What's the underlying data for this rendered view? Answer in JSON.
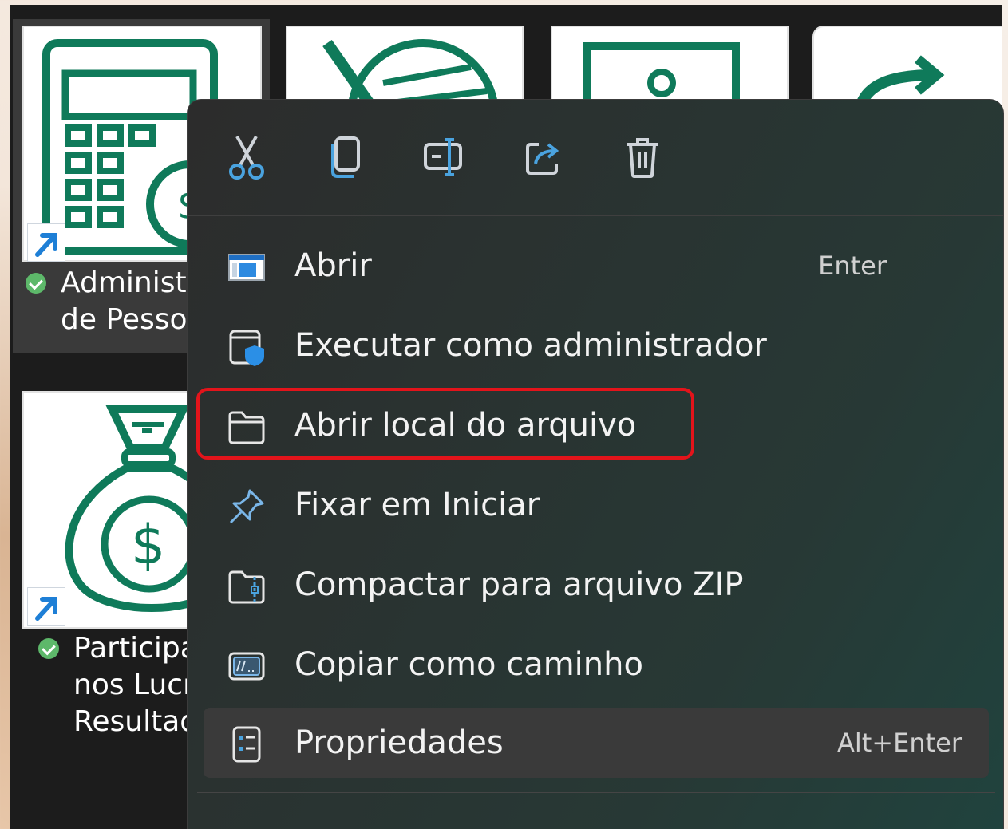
{
  "files": [
    {
      "id": "file-admin",
      "lines": [
        "Administr",
        "de Pessoa"
      ],
      "icon": "calculator-dollar-icon"
    },
    {
      "id": "file-participacao",
      "lines": [
        "Participa",
        "nos Lucr",
        "Resultad"
      ],
      "icon": "money-bag-icon"
    },
    {
      "id": "file-tile-3",
      "icon": "no-money-icon"
    },
    {
      "id": "file-tile-4",
      "icon": "id-card-icon"
    },
    {
      "id": "file-tile-5",
      "icon": "transfer-arrow-icon"
    }
  ],
  "toolbar": {
    "actions": [
      {
        "name": "cut",
        "icon": "scissors-icon"
      },
      {
        "name": "copy",
        "icon": "copy-icon"
      },
      {
        "name": "rename",
        "icon": "rename-icon"
      },
      {
        "name": "share",
        "icon": "share-icon"
      },
      {
        "name": "delete",
        "icon": "trash-icon"
      }
    ]
  },
  "menu": {
    "items": [
      {
        "label": "Abrir",
        "shortcut": "Enter",
        "icon": "open-window-icon"
      },
      {
        "label": "Executar como administrador",
        "shortcut": "",
        "icon": "shield-admin-icon"
      },
      {
        "label": "Abrir local do arquivo",
        "shortcut": "",
        "icon": "folder-icon",
        "highlighted": true
      },
      {
        "label": "Fixar em Iniciar",
        "shortcut": "",
        "icon": "pin-icon"
      },
      {
        "label": "Compactar para arquivo ZIP",
        "shortcut": "",
        "icon": "zip-folder-icon"
      },
      {
        "label": "Copiar como caminho",
        "shortcut": "",
        "icon": "path-icon"
      },
      {
        "label": "Propriedades",
        "shortcut": "Alt+Enter",
        "icon": "properties-icon",
        "hovered": true
      }
    ]
  },
  "colors": {
    "tile_icon_green": "#0f7a5a",
    "highlight_red": "#e3141b",
    "toolbar_icon_blue": "#4aa3df",
    "menu_bg": "#2c2c2c"
  }
}
